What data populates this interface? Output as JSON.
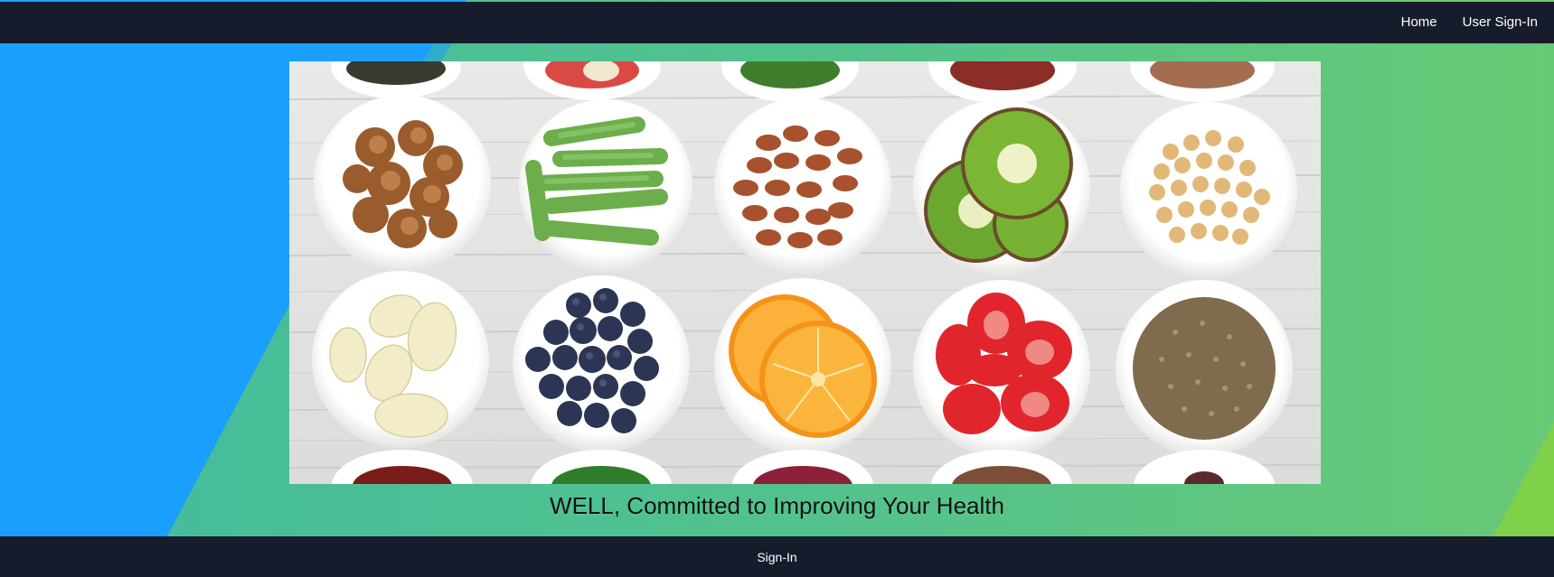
{
  "nav": {
    "links": [
      {
        "label": "Home"
      },
      {
        "label": "User Sign-In"
      }
    ]
  },
  "hero": {
    "tagline": "WELL, Committed to Improving Your Health",
    "image_subject": "bowls of walnuts, asparagus, beans, kiwi, chickpeas, garlic, blueberries, orange slices, strawberries, hemp seeds on white wooden table"
  },
  "footer": {
    "link_label": "Sign-In"
  },
  "colors": {
    "nav_bg": "#161c2b",
    "bg_blue": "#1a9ffd",
    "bg_green_left": "#4dbf95",
    "bg_green_right": "#6cc96f",
    "bg_lime": "#7fd14a"
  }
}
